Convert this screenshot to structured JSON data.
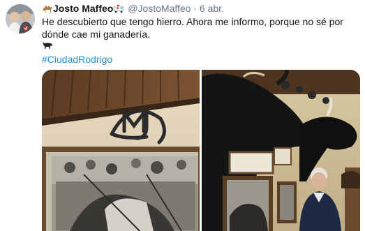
{
  "tweet": {
    "display_name": "Josto Maffeo",
    "handle": "@JostoMaffeo",
    "separator": "·",
    "date": "6 abr.",
    "text": "He descubierto que tengo hierro. Ahora me informo, porque no sé por dónde cae mi ganadería.",
    "hashtag": "#CiudadRodrigo",
    "name_emojis": [
      "camel-emoji",
      "ambulance-emoji"
    ],
    "body_emoji": "bull-emoji"
  },
  "media": [
    {
      "label": "photo-brand-mark-and-bullfight-print"
    },
    {
      "label": "photo-bull-heads-and-man"
    }
  ]
}
